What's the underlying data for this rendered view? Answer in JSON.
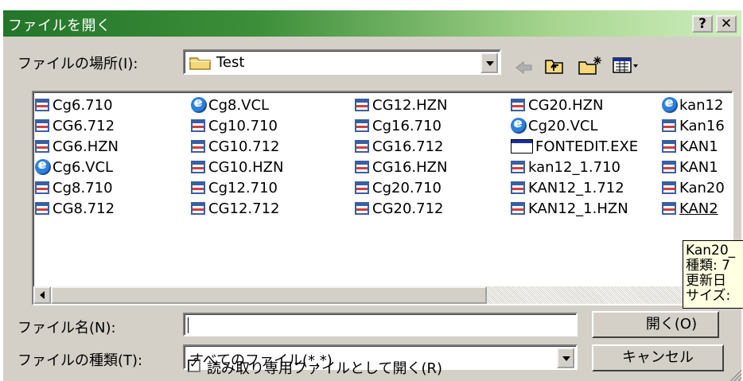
{
  "window": {
    "title": "ファイルを開く",
    "help_label": "?",
    "close_label": "✕"
  },
  "location": {
    "label": "ファイルの場所(I):",
    "value": "Test"
  },
  "toolbar": [
    "back-icon",
    "up-folder-icon",
    "new-folder-icon",
    "view-menu-icon"
  ],
  "files": [
    [
      "Cg6.710",
      "CG6.712",
      "CG6.HZN",
      "Cg6.VCL",
      "Cg8.710",
      "CG8.712"
    ],
    [
      "Cg8.VCL",
      "Cg10.710",
      "CG10.712",
      "CG10.HZN",
      "Cg12.710",
      "CG12.712"
    ],
    [
      "CG12.HZN",
      "Cg16.710",
      "CG16.712",
      "CG16.HZN",
      "Cg20.710",
      "CG20.712"
    ],
    [
      "CG20.HZN",
      "Cg20.VCL",
      "FONTEDIT.EXE",
      "kan12_1.710",
      "KAN12_1.712",
      "KAN12_1.HZN"
    ],
    [
      "kan12",
      "Kan16",
      "KAN1",
      "KAN1",
      "Kan20",
      "KAN2"
    ]
  ],
  "filename": {
    "label": "ファイル名(N):",
    "value": ""
  },
  "filetype": {
    "label": "ファイルの種類(T):",
    "value": "すべてのファイル(*.*)"
  },
  "readonly": {
    "label": "読み取り専用ファイルとして開く(R)",
    "checked": true
  },
  "buttons": {
    "open": "開く(O)",
    "cancel": "キャンセル"
  },
  "tooltip": {
    "lines": [
      "Kan20_",
      "種類: 7",
      "更新日",
      "サイズ:"
    ]
  },
  "colors": {
    "title_start": "#23752a",
    "title_end": "#cfeebf",
    "face": "#d4d0c8",
    "tooltip_bg": "#ffffe1"
  }
}
